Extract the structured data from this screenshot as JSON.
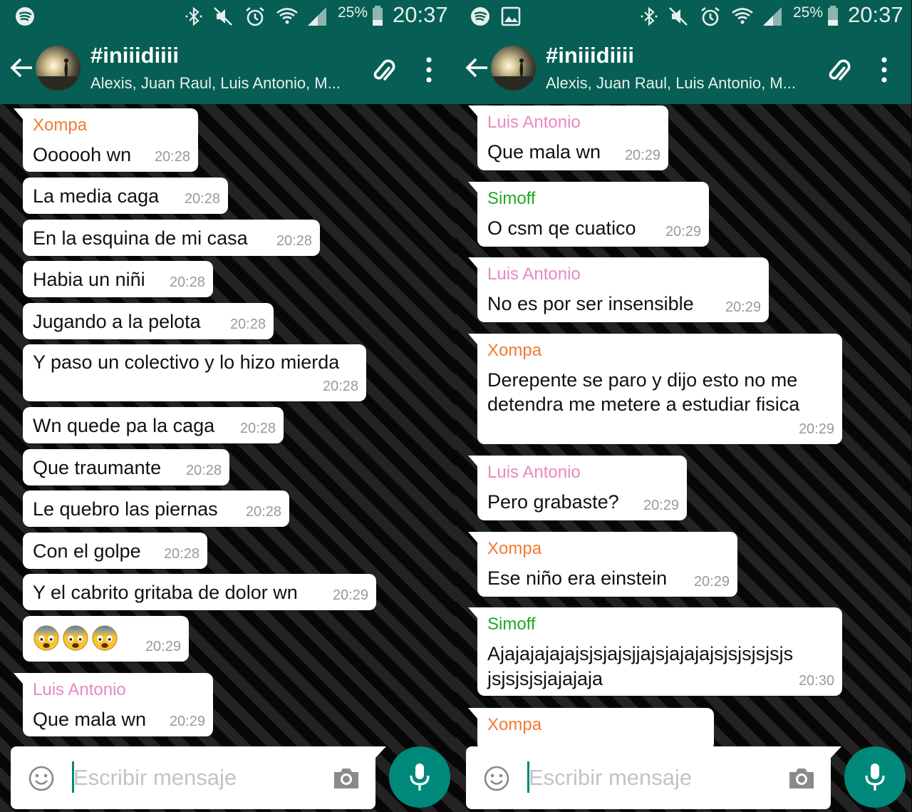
{
  "status_bar": {
    "battery_percent": "25%",
    "time": "20:37"
  },
  "header": {
    "title": "#iniiidiiii",
    "members": "Alexis, Juan Raul, Luis Antonio, M..."
  },
  "input": {
    "placeholder": "Escribir mensaje"
  },
  "colors": {
    "primary": "#075e54",
    "accent": "#00897b",
    "xompa": "#f07a34",
    "luis_antonio": "#e889c0",
    "simoff": "#1fa824"
  },
  "screens": [
    {
      "messages": [
        {
          "sender": "Xompa",
          "lines": [
            "Oooooh wn"
          ],
          "time": "20:28"
        },
        {
          "lines": [
            "La media caga"
          ],
          "time": "20:28"
        },
        {
          "lines": [
            "En la esquina de mi casa"
          ],
          "time": "20:28"
        },
        {
          "lines": [
            "Habia un niñi"
          ],
          "time": "20:28"
        },
        {
          "lines": [
            "Jugando a la pelota"
          ],
          "time": "20:28"
        },
        {
          "lines": [
            "Y paso un colectivo y lo hizo mierda"
          ],
          "time": "20:28"
        },
        {
          "lines": [
            "Wn quede pa la caga"
          ],
          "time": "20:28"
        },
        {
          "lines": [
            "Que traumante"
          ],
          "time": "20:28"
        },
        {
          "lines": [
            "Le quebro las piernas"
          ],
          "time": "20:28"
        },
        {
          "lines": [
            "Con el golpe"
          ],
          "time": "20:28"
        },
        {
          "lines": [
            "Y el cabrito gritaba de dolor wn"
          ],
          "time": "20:29"
        },
        {
          "emojis": [
            "fearful-face",
            "fearful-face",
            "fearful-face"
          ],
          "time": "20:29"
        },
        {
          "sender": "Luis Antonio",
          "lines": [
            "Que mala wn"
          ],
          "time": "20:29"
        }
      ]
    },
    {
      "messages": [
        {
          "sender": "Luis Antonio",
          "lines": [
            "Que mala wn"
          ],
          "time": "20:29"
        },
        {
          "sender": "Simoff",
          "lines": [
            "O csm qe cuatico"
          ],
          "time": "20:29"
        },
        {
          "sender": "Luis Antonio",
          "lines": [
            "No es por ser insensible"
          ],
          "time": "20:29"
        },
        {
          "sender": "Xompa",
          "lines": [
            "Derepente se paro y dijo esto no me",
            "detendra me metere a estudiar fisica"
          ],
          "time": "20:29"
        },
        {
          "sender": "Luis Antonio",
          "lines": [
            "Pero grabaste?"
          ],
          "time": "20:29"
        },
        {
          "sender": "Xompa",
          "lines": [
            "Ese niño era einstein"
          ],
          "time": "20:29"
        },
        {
          "sender": "Simoff",
          "lines": [
            "Ajajajajajajsjsjajsjjajsjajajajsjsjsjsjsjs",
            "jsjsjsjsjajajaja"
          ],
          "time": "20:30"
        },
        {
          "sender": "Xompa"
        }
      ]
    }
  ]
}
